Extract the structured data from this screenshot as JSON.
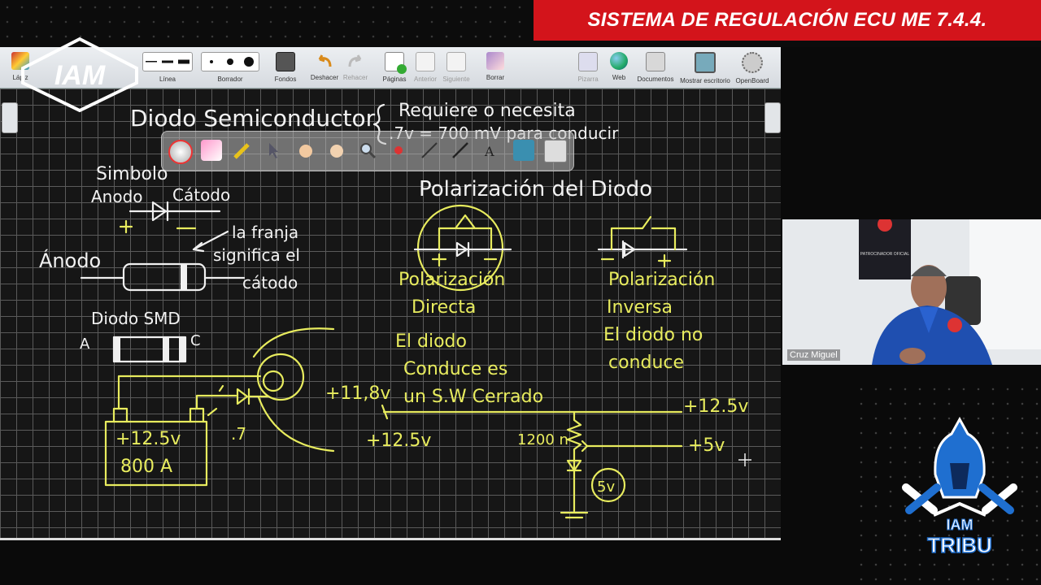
{
  "banner": {
    "title": "SISTEMA DE REGULACIÓN ECU ME 7.4.4."
  },
  "toolbar": {
    "buttons": [
      {
        "label": "Lápiz",
        "icon": "pencil-icon",
        "enabled": true
      },
      {
        "label": "Línea",
        "icon": "line-width-icon",
        "enabled": true
      },
      {
        "label": "Borrador",
        "icon": "eraser-size-icon",
        "enabled": true
      },
      {
        "label": "Fondos",
        "icon": "background-icon",
        "enabled": true
      },
      {
        "label": "Deshacer",
        "icon": "undo-icon",
        "enabled": true
      },
      {
        "label": "Rehacer",
        "icon": "redo-icon",
        "enabled": false
      },
      {
        "label": "Páginas",
        "icon": "pages-icon",
        "enabled": true
      },
      {
        "label": "Anterior",
        "icon": "previous-icon",
        "enabled": false
      },
      {
        "label": "Siguiente",
        "icon": "next-icon",
        "enabled": false
      },
      {
        "label": "Borrar",
        "icon": "clear-icon",
        "enabled": true
      },
      {
        "label": "Pizarra",
        "icon": "board-icon",
        "enabled": false
      },
      {
        "label": "Web",
        "icon": "globe-icon",
        "enabled": true
      },
      {
        "label": "Documentos",
        "icon": "folder-icon",
        "enabled": true
      },
      {
        "label": "Mostrar escritorio",
        "icon": "desktop-icon",
        "enabled": true
      },
      {
        "label": "OpenBoard",
        "icon": "gear-icon",
        "enabled": true
      }
    ]
  },
  "whiteboard": {
    "heading": "Diodo Semiconductor",
    "note_line1": "Requiere o necesita",
    "note_line2": ".7v = 700 mV para conducir",
    "simbolo": "Simbolo",
    "anodo": "Anodo",
    "catodo": "Cátodo",
    "anodo_big": "Ánodo",
    "franja": [
      "la franja",
      "significa el",
      "cátodo"
    ],
    "smd": "Diodo SMD",
    "smd_a": "A",
    "smd_c": "C",
    "battery": [
      "+12.5v",
      "800 A"
    ],
    "point7": ".7",
    "v1186": "+11,8v",
    "polarizacion_title": "Polarización del Diodo",
    "directa": [
      "Polarización",
      "Directa",
      "El diodo",
      "Conduce es",
      "un S.W Cerrado"
    ],
    "inversa": [
      "Polarización",
      "Inversa",
      "El diodo no",
      "conduce"
    ],
    "v125_left": "+12.5v",
    "v125_right": "+12.5v",
    "v5": "+5v",
    "r1200": "1200 n",
    "circle_5v": "5v"
  },
  "webcam": {
    "participant": "Cruz Miguel",
    "poster_text": "PATROCINADOR OFICIAL"
  },
  "logos": {
    "iam_text": "IAM",
    "tribu_top": "IAM",
    "tribu_bottom": "TRIBU"
  },
  "colors": {
    "banner_red": "#d3141b",
    "ink_yellow": "#e8ec5e",
    "ink_white": "#f0f0f0"
  }
}
